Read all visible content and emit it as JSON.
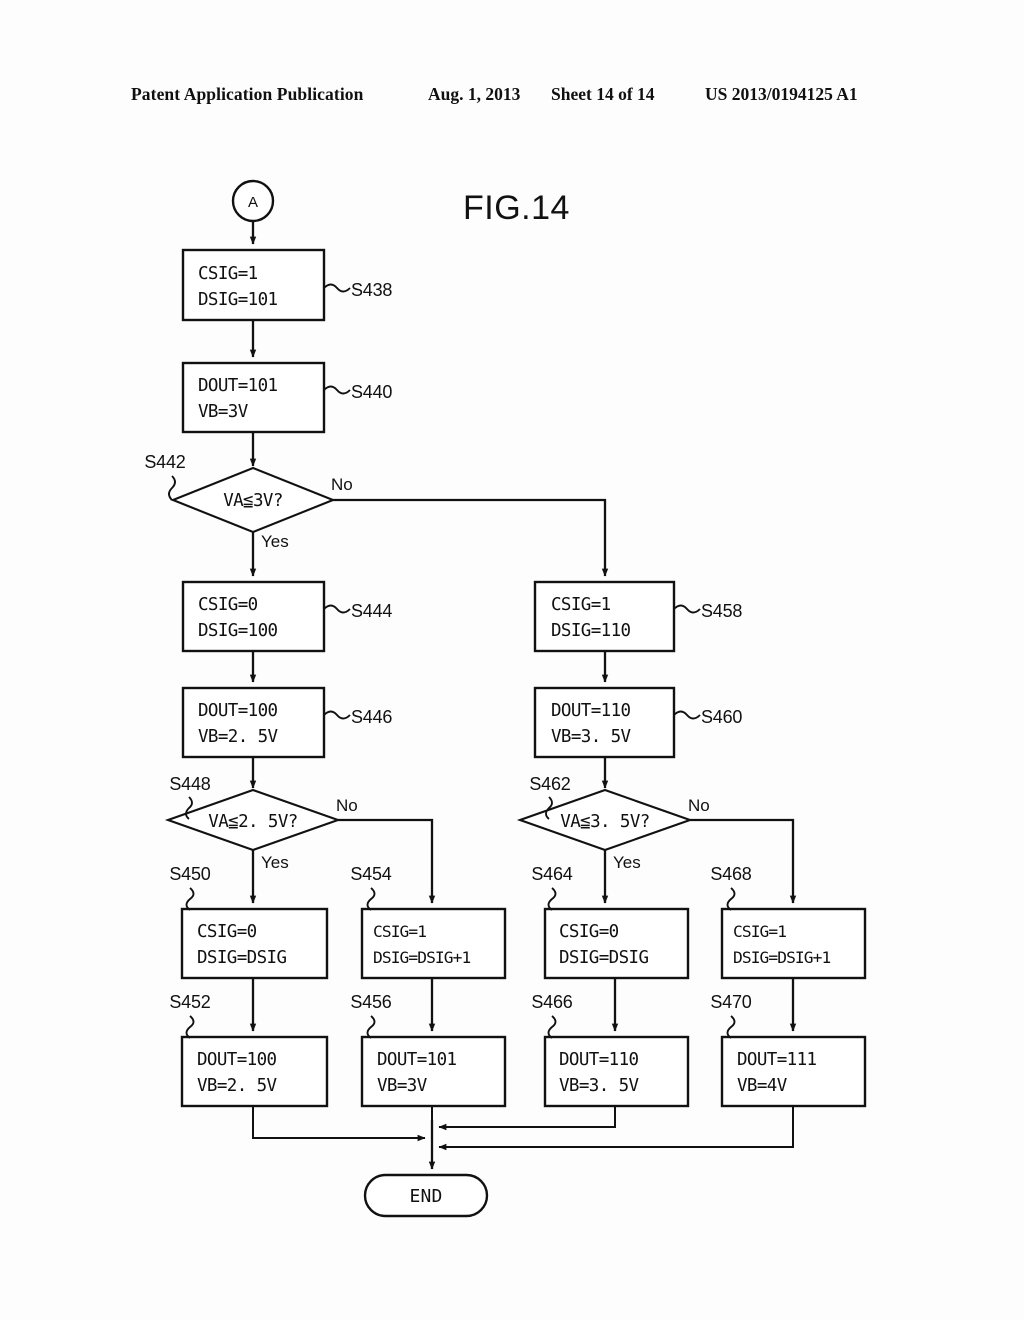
{
  "header": {
    "publication": "Patent Application Publication",
    "date": "Aug. 1, 2013",
    "sheet": "Sheet 14 of 14",
    "number": "US 2013/0194125 A1"
  },
  "figure": {
    "title": "FIG.14",
    "connector_in": "A",
    "terminator": "END"
  },
  "nodes": {
    "s438": {
      "step": "S438",
      "line1": "CSIG=1",
      "line2": "DSIG=101"
    },
    "s440": {
      "step": "S440",
      "line1": "DOUT=101",
      "line2": "VB=3V"
    },
    "s442": {
      "step": "S442",
      "condition": "VA≦3V?",
      "yes": "Yes",
      "no": "No"
    },
    "s444": {
      "step": "S444",
      "line1": "CSIG=0",
      "line2": "DSIG=100"
    },
    "s446": {
      "step": "S446",
      "line1": "DOUT=100",
      "line2": "VB=2. 5V"
    },
    "s448": {
      "step": "S448",
      "condition": "VA≦2. 5V?",
      "yes": "Yes",
      "no": "No"
    },
    "s450": {
      "step": "S450",
      "line1": "CSIG=0",
      "line2": "DSIG=DSIG"
    },
    "s452": {
      "step": "S452",
      "line1": "DOUT=100",
      "line2": "VB=2. 5V"
    },
    "s454": {
      "step": "S454",
      "line1": "CSIG=1",
      "line2": "DSIG=DSIG+1"
    },
    "s456": {
      "step": "S456",
      "line1": "DOUT=101",
      "line2": "VB=3V"
    },
    "s458": {
      "step": "S458",
      "line1": "CSIG=1",
      "line2": "DSIG=110"
    },
    "s460": {
      "step": "S460",
      "line1": "DOUT=110",
      "line2": "VB=3. 5V"
    },
    "s462": {
      "step": "S462",
      "condition": "VA≦3. 5V?",
      "yes": "Yes",
      "no": "No"
    },
    "s464": {
      "step": "S464",
      "line1": "CSIG=0",
      "line2": "DSIG=DSIG"
    },
    "s466": {
      "step": "S466",
      "line1": "DOUT=110",
      "line2": "VB=3. 5V"
    },
    "s468": {
      "step": "S468",
      "line1": "CSIG=1",
      "line2": "DSIG=DSIG+1"
    },
    "s470": {
      "step": "S470",
      "line1": "DOUT=111",
      "line2": "VB=4V"
    }
  }
}
